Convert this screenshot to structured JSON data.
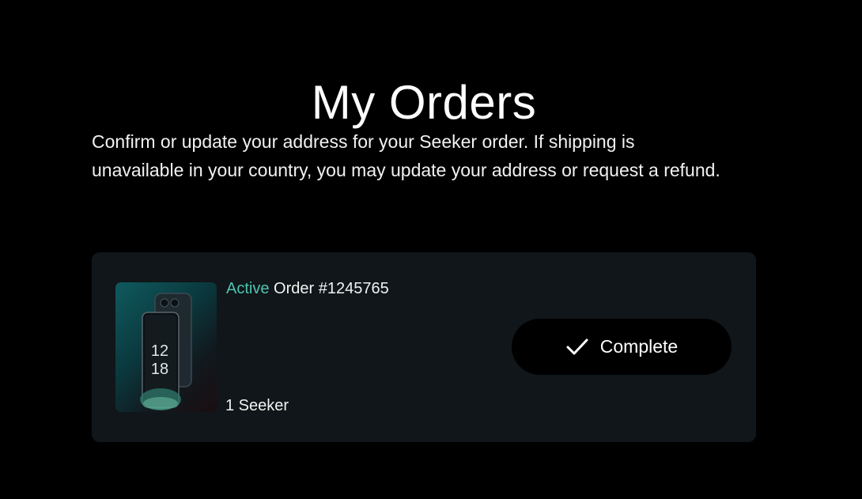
{
  "page": {
    "title": "My Orders",
    "intro": "Confirm or update your address for your Seeker order. If shipping is unavailable in your country, you may update your address or request a refund."
  },
  "order": {
    "status": "Active",
    "number_label": " Order #1245765",
    "quantity": "1 Seeker",
    "image_clock": {
      "hour": "12",
      "minute": "18"
    },
    "action_label": "Complete",
    "action_icon": "check-icon"
  },
  "colors": {
    "background": "#000000",
    "card": "#101619",
    "status_accent": "#4ec3b0"
  }
}
